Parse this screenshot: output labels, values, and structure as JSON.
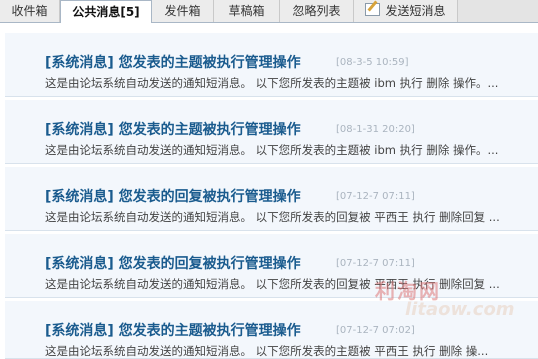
{
  "tabs": [
    {
      "label": "收件箱"
    },
    {
      "label": "公共消息[5]"
    },
    {
      "label": "发件箱"
    },
    {
      "label": "草稿箱"
    },
    {
      "label": "忽略列表"
    },
    {
      "label": "发送短消息",
      "icon": "compose-icon"
    }
  ],
  "active_tab": "公共消息[5]",
  "messages": [
    {
      "title": "[系统消息] 您发表的主题被执行管理操作",
      "date": "[08-3-5 10:59]",
      "body": "这是由论坛系统自动发送的通知短消息。 以下您所发表的主题被 ibm 执行 删除 操作。..."
    },
    {
      "title": "[系统消息] 您发表的主题被执行管理操作",
      "date": "[08-1-31 20:20]",
      "body": "这是由论坛系统自动发送的通知短消息。 以下您所发表的主题被 ibm 执行 删除 操作。..."
    },
    {
      "title": "[系统消息] 您发表的回复被执行管理操作",
      "date": "[07-12-7 07:11]",
      "body": "这是由论坛系统自动发送的通知短消息。 以下您所发表的回复被 平西王 执行 删除回复 ..."
    },
    {
      "title": "[系统消息] 您发表的回复被执行管理操作",
      "date": "[07-12-7 07:11]",
      "body": "这是由论坛系统自动发送的通知短消息。 以下您所发表的回复被 平西王 执行 删除回复 ..."
    },
    {
      "title": "[系统消息] 您发表的主题被执行管理操作",
      "date": "[07-12-7 07:02]",
      "body": "这是由论坛系统自动发送的通知短消息。 以下您所发表的主题被 平西王 执行 删除 操..."
    }
  ],
  "watermark": {
    "main": "利淘网",
    "sub": "litaow.com"
  },
  "colors": {
    "title": "#1a5b8e",
    "date": "#aab4bf",
    "row_bg": "#f3f7fc",
    "tabbar_bg": "#e4e4e4"
  }
}
